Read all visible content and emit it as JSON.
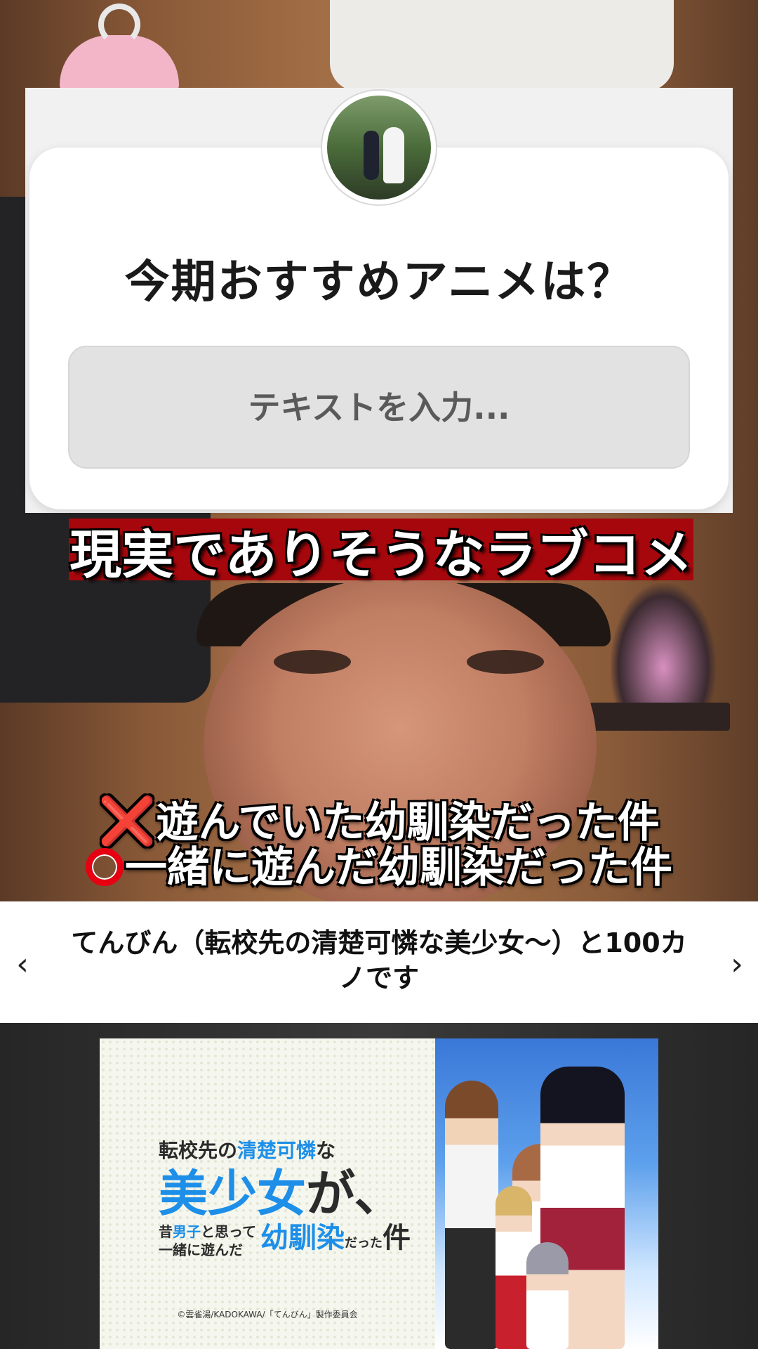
{
  "question_sticker": {
    "question": "今期おすすめアニメは？",
    "input_placeholder": "テキストを入力..."
  },
  "captions": {
    "main": "現実でありそうなラブコメ",
    "line1_mark": "❌",
    "line1_text": "遊んでいた幼馴染だった件",
    "line2_text": "一緒に遊んだ幼馴染だった件"
  },
  "title_bar": {
    "prev_icon": "‹",
    "next_icon": "›",
    "title": "てんびん（転校先の清楚可憐な美少女〜）と100カノです"
  },
  "key_visual": {
    "logo_line1_a": "転校先の",
    "logo_line1_b": "清楚可憐",
    "logo_line1_c": "な",
    "logo_line2_a": "美少女",
    "logo_line2_b": "が、",
    "logo_line3_a": "昔",
    "logo_line3_b": "男子",
    "logo_line3_c": "と思って",
    "logo_line4": "一緒に遊んだ",
    "logo_line5_a": "幼馴染",
    "logo_line5_b": "だった",
    "logo_line5_c": "件",
    "copyright": "©雲雀湯/KADOKAWA/「てんびん」製作委員会"
  },
  "colors": {
    "caption_bar": "#a6070c",
    "mark_red": "#e60012",
    "logo_blue": "#1d8fe8"
  }
}
